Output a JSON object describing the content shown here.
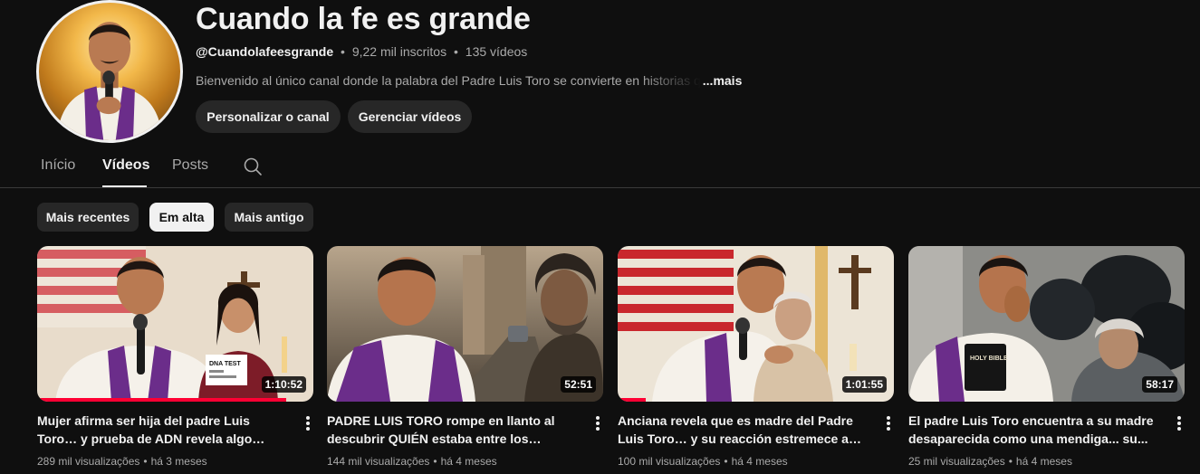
{
  "channel": {
    "name": "Cuando la fe es grande",
    "handle": "@Cuandolafeesgrande",
    "subscribers": "9,22 mil inscritos",
    "video_count": "135 vídeos",
    "separator": "•",
    "description": "Bienvenido al único canal donde la palabra del Padre Luis Toro se convierte en historias q",
    "more_label": "...mais"
  },
  "actions": {
    "customize_label": "Personalizar o canal",
    "manage_label": "Gerenciar vídeos"
  },
  "tabs": [
    {
      "label": "Início",
      "active": false
    },
    {
      "label": "Vídeos",
      "active": true
    },
    {
      "label": "Posts",
      "active": false
    }
  ],
  "chips": [
    {
      "label": "Mais recentes",
      "active": false
    },
    {
      "label": "Em alta",
      "active": true
    },
    {
      "label": "Mais antigo",
      "active": false
    }
  ],
  "videos": [
    {
      "title": "Mujer afirma ser hija del padre Luis Toro… y prueba de ADN revela algo increíble",
      "views": "289 mil visualizações",
      "age": "há 3 meses",
      "duration": "1:10:52",
      "watched_fraction": 0.9
    },
    {
      "title": "PADRE LUIS TORO rompe en llanto al descubrir QUIÉN estaba entre los mendigo...",
      "views": "144 mil visualizações",
      "age": "há 4 meses",
      "duration": "52:51",
      "watched_fraction": 0
    },
    {
      "title": "Anciana revela que es madre del Padre Luis Toro… y su reacción estremece a todos",
      "views": "100 mil visualizações",
      "age": "há 4 meses",
      "duration": "1:01:55",
      "watched_fraction": 0.1
    },
    {
      "title": "El padre Luis Toro encuentra a su madre desaparecida como una mendiga... su...",
      "views": "25 mil visualizações",
      "age": "há 4 meses",
      "duration": "58:17",
      "watched_fraction": 0
    }
  ],
  "thumb_text": {
    "dna_test": "DNA TEST",
    "bible": "HOLY BIBLE"
  },
  "colors": {
    "background": "#0f0f0f",
    "chip": "#272727",
    "chip_active": "#f1f1f1",
    "text_primary": "#f1f1f1",
    "text_secondary": "#aaaaaa",
    "progress": "#ff0033",
    "vestment_purple": "#6b2d8a"
  }
}
